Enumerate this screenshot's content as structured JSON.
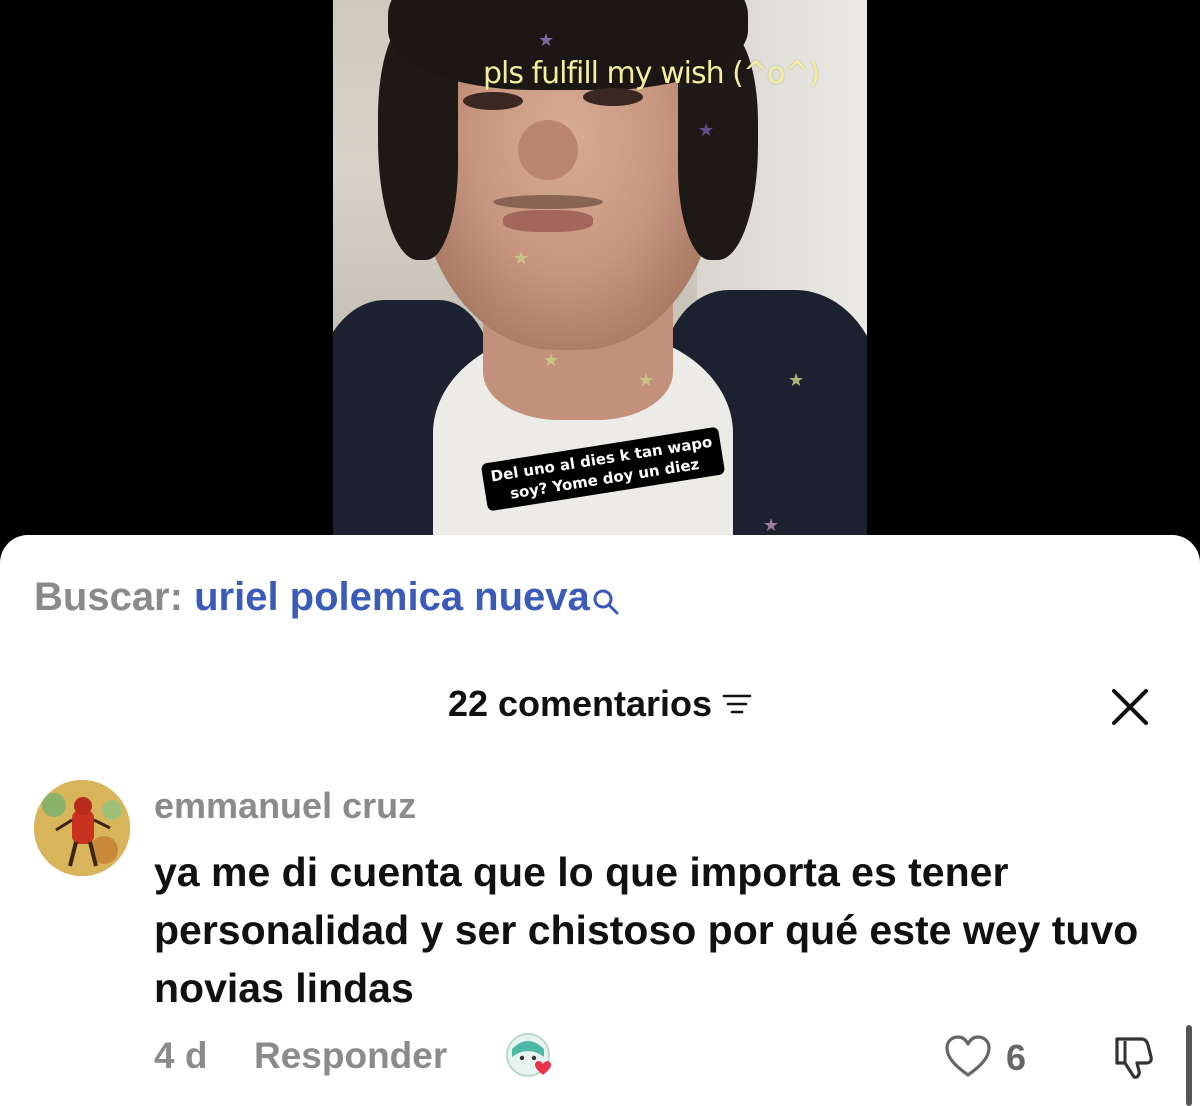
{
  "video": {
    "caption_top": "pls fulfill my wish (^o^)",
    "caption_bottom_line1": "Del uno al dies k tan wapo",
    "caption_bottom_line2": "soy? Yome doy un diez"
  },
  "search": {
    "prefix": "Buscar:",
    "term": "uriel polemica nueva",
    "icon": "search-icon"
  },
  "comments": {
    "count_label": "22 comentarios",
    "filter_icon": "filter-icon",
    "close_icon": "close-icon"
  },
  "comment": {
    "username": "emmanuel cruz",
    "text": "ya me di cuenta que lo que importa es tener personalidad y ser chistoso por qué este wey tuvo novias lindas",
    "time": "4 d",
    "reply_label": "Responder",
    "likes": "6",
    "accent_color": "#e8334a",
    "link_color": "#3b5bb8"
  }
}
